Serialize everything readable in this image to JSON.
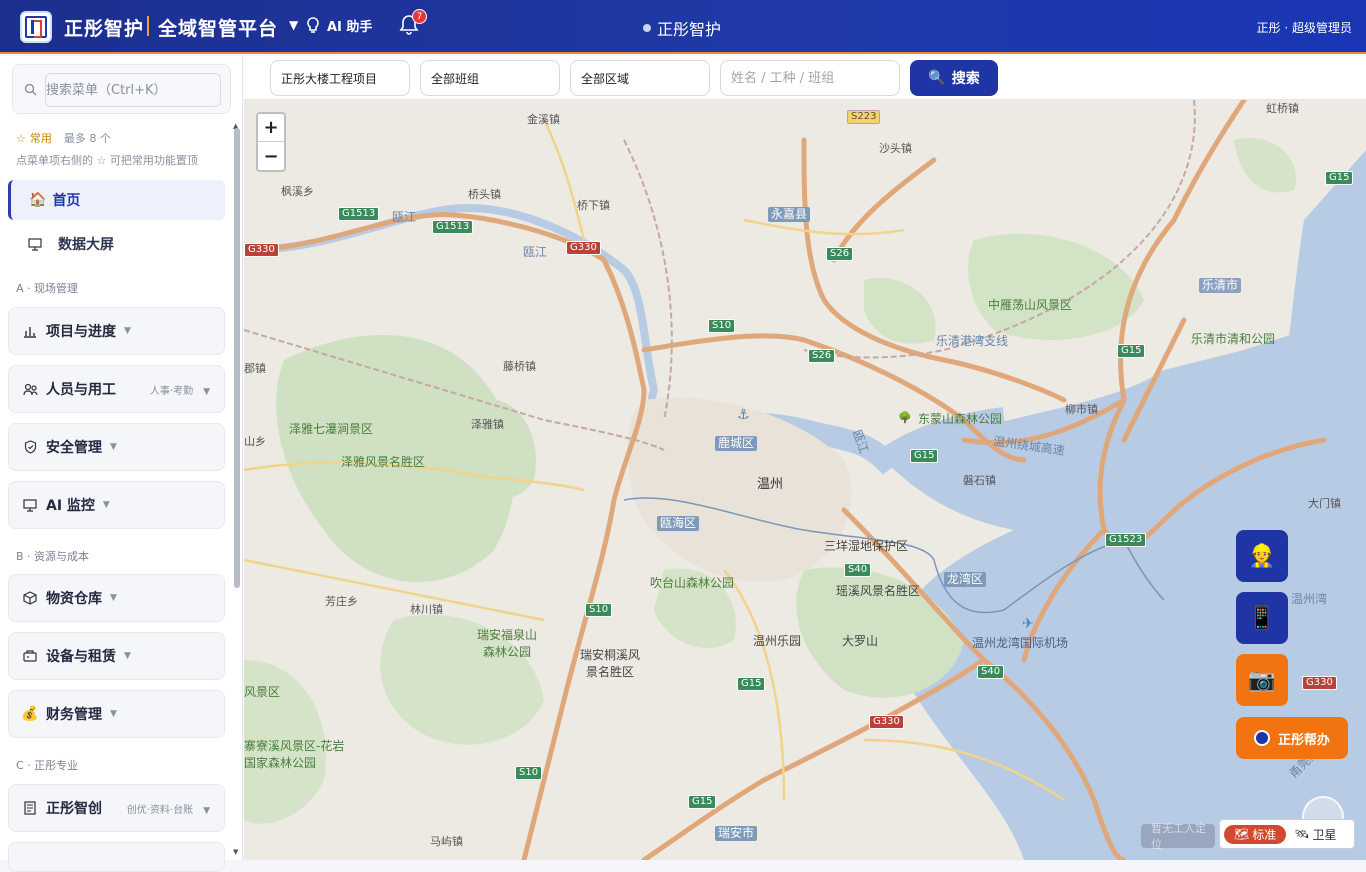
{
  "header": {
    "brand": "正彤智护",
    "platform": "全域智管平台",
    "ai_label": "AI 助手",
    "notif_count": "7",
    "center_title": "正彤智护",
    "user": "正彤 · 超级管理员"
  },
  "sidebar": {
    "search_placeholder": "搜索菜单（Ctrl+K）",
    "fav_label": "常用",
    "fav_max": "最多 8 个",
    "fav_hint": "点菜单项右侧的 ☆ 可把常用功能置顶",
    "home": "首页",
    "data_screen": "数据大屏",
    "section_a": "A · 现场管理",
    "section_b": "B · 资源与成本",
    "section_c": "C · 正彤专业",
    "items": [
      {
        "label": "项目与进度",
        "sub": ""
      },
      {
        "label": "人员与用工",
        "sub": "人事·考勤"
      },
      {
        "label": "安全管理",
        "sub": ""
      },
      {
        "label": "AI 监控",
        "sub": ""
      },
      {
        "label": "物资仓库",
        "sub": ""
      },
      {
        "label": "设备与租赁",
        "sub": ""
      },
      {
        "label": "财务管理",
        "sub": ""
      },
      {
        "label": "正彤智创",
        "sub": "创优·资料·台账"
      }
    ]
  },
  "filters": {
    "project": "正彤大楼工程项目",
    "team": "全部班组",
    "area": "全部区域",
    "search_placeholder": "姓名 / 工种 / 班组",
    "search_btn": "搜索"
  },
  "map": {
    "labels": {
      "jinxi": "金溪镇",
      "shazhen": "沙头镇",
      "huangtan": "桥头镇",
      "guxia": "桥下镇",
      "xiaqiao": "枫溪乡",
      "yongjia": "永嘉县",
      "zhongyan": "中雁荡山风景区",
      "yueqing": "乐清市",
      "qinghe": "乐清市清和公园",
      "tengqiao": "藤桥镇",
      "zeya": "泽雅七瀑涧景区",
      "zeyafj": "泽雅风景名胜区",
      "zeyazhen": "泽雅镇",
      "lucheng": "鹿城区",
      "wenzhou": "温州",
      "dongmeng": "东蒙山森林公园",
      "raoxian": "温州绕城高速",
      "ouhai": "瓯海区",
      "sanyang": "三垟湿地保护区",
      "yaoxi": "瑶溪风景名胜区",
      "longwan": "龙湾区",
      "chuitai": "吹台山森林公园",
      "lezhuang": "芳庄乡",
      "linchuan": "林川镇",
      "ruian": "瑞安福泉山森林公园",
      "ruitong": "瑞安桐溪风景名胜区",
      "wzly": "温州乐园",
      "daluo": "大罗山",
      "airport": "温州龙湾国际机场",
      "zhaiyao": "寨寮溪风景区-花岩国家森林公园",
      "mashan": "马屿镇",
      "ruianshi": "瑞安市",
      "baishi": "磐石镇",
      "liushi": "柳市镇",
      "damen": "大门镇",
      "wenzhouwan": "温州湾",
      "hongqiao": "虹桥镇",
      "yueqinggang": "乐清港湾支线",
      "nantang": "甬莞高速",
      "shanxiang": "山乡",
      "fengjing": "风景区",
      "ouj": "瓯江",
      "ouj2": "瓯江",
      "ouj3": "瓯江",
      "juntian": "郡镇"
    },
    "shields": {
      "g1513a": "G1513",
      "g1513b": "G1513",
      "g330a": "G330",
      "g330b": "G330",
      "s223": "S223",
      "s26a": "S26",
      "s26b": "S26",
      "s10a": "S10",
      "s10b": "S10",
      "s10c": "S10",
      "g15a": "G15",
      "g15b": "G15",
      "g15c": "G15",
      "g15d": "G15",
      "g15e": "G15",
      "s40a": "S40",
      "s40b": "S40",
      "g1523": "G1523",
      "g330c": "G330",
      "g330d": "G330"
    },
    "layer_std": "标准",
    "layer_sat": "卫星",
    "ghost": "暂无工人定位"
  },
  "fabs": {
    "help": "正彤帮办"
  }
}
